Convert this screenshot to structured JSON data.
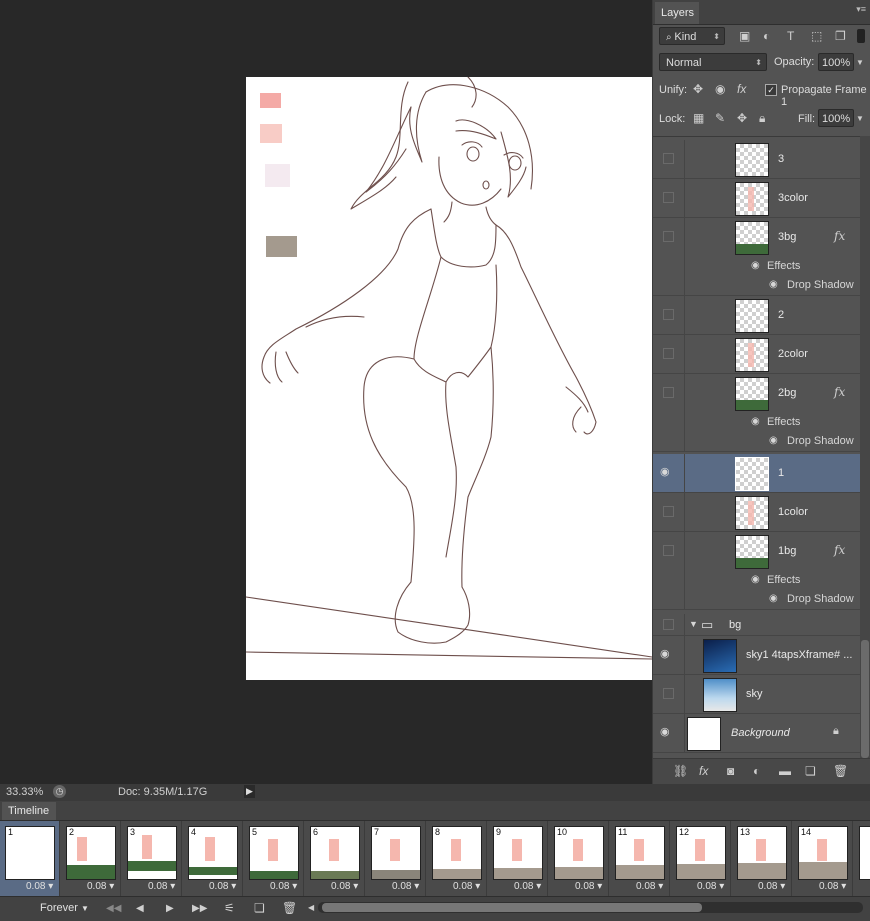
{
  "layers_panel": {
    "tab": "Layers",
    "filter_kind": "Kind",
    "blend_mode": "Normal",
    "opacity_label": "Opacity:",
    "opacity_value": "100%",
    "unify_label": "Unify:",
    "propagate_label": "Propagate Frame 1",
    "lock_label": "Lock:",
    "fill_label": "Fill:",
    "fill_value": "100%",
    "layers": [
      {
        "name": "3",
        "visible": false
      },
      {
        "name": "3color",
        "visible": false
      },
      {
        "name": "3bg",
        "visible": false,
        "fx": "fx",
        "effects": "Effects",
        "effect": "Drop Shadow"
      },
      {
        "name": "2",
        "visible": false
      },
      {
        "name": "2color",
        "visible": false
      },
      {
        "name": "2bg",
        "visible": false,
        "fx": "fx",
        "effects": "Effects",
        "effect": "Drop Shadow"
      },
      {
        "name": "1",
        "visible": true,
        "selected": true
      },
      {
        "name": "1color",
        "visible": false
      },
      {
        "name": "1bg",
        "visible": false,
        "fx": "fx",
        "effects": "Effects",
        "effect": "Drop Shadow"
      },
      {
        "name": "bg",
        "visible": false,
        "group": true
      },
      {
        "name": "sky1 4tapsXframe# ...",
        "visible": true
      },
      {
        "name": "sky",
        "visible": false
      },
      {
        "name": "Background",
        "visible": true,
        "locked": true
      }
    ]
  },
  "status": {
    "zoom": "33.33%",
    "doc": "Doc: 9.35M/1.17G"
  },
  "timeline": {
    "tab": "Timeline",
    "loop": "Forever",
    "frames": [
      {
        "num": "1",
        "delay": "0.08"
      },
      {
        "num": "2",
        "delay": "0.08"
      },
      {
        "num": "3",
        "delay": "0.08"
      },
      {
        "num": "4",
        "delay": "0.08"
      },
      {
        "num": "5",
        "delay": "0.08"
      },
      {
        "num": "6",
        "delay": "0.08"
      },
      {
        "num": "7",
        "delay": "0.08"
      },
      {
        "num": "8",
        "delay": "0.08"
      },
      {
        "num": "9",
        "delay": "0.08"
      },
      {
        "num": "10",
        "delay": "0.08"
      },
      {
        "num": "11",
        "delay": "0.08"
      },
      {
        "num": "12",
        "delay": "0.08"
      },
      {
        "num": "13",
        "delay": "0.08"
      },
      {
        "num": "14",
        "delay": "0.08"
      },
      {
        "num": "",
        "delay": ""
      }
    ]
  },
  "colors": {
    "swatch_1": "#f4aaa6",
    "swatch_2": "#f8ccc6",
    "swatch_3": "#f4eaf0",
    "swatch_4": "#a49a8e",
    "line_art": "#6e4f4c",
    "selection": "#5a6b85"
  }
}
